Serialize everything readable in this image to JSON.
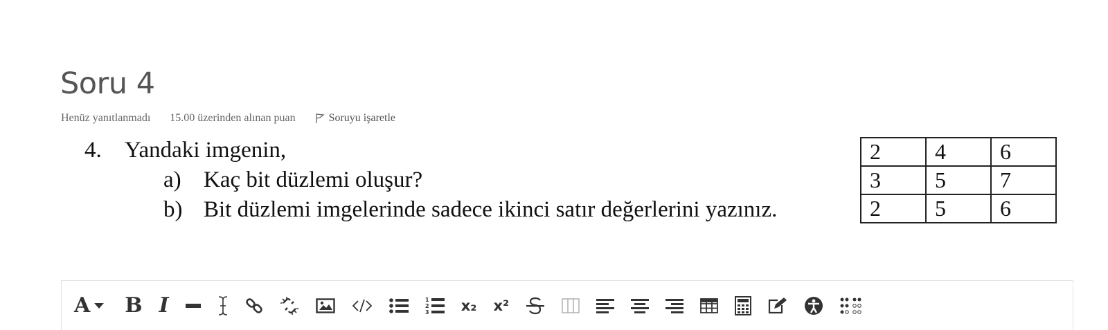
{
  "question": {
    "title": "Soru 4",
    "status": "Henüz yanıtlanmadı",
    "points": "15.00 üzerinden alınan puan",
    "flag_label": "Soruyu işaretle",
    "number": "4.",
    "prompt": "Yandaki imgenin,",
    "subs": [
      {
        "label": "a)",
        "text": "Kaç bit düzlemi oluşur?"
      },
      {
        "label": "b)",
        "text": "Bit düzlemi imgelerinde sadece ikinci satır değerlerini yazınız."
      }
    ],
    "table": [
      [
        "2",
        "4",
        "6"
      ],
      [
        "3",
        "5",
        "7"
      ],
      [
        "2",
        "5",
        "6"
      ]
    ]
  },
  "toolbar": {
    "font_label": "A",
    "bold_label": "B",
    "italic_label": "I",
    "subscript_label": "x₂",
    "superscript_label": "x²",
    "buttons": [
      "font-family",
      "bold",
      "italic",
      "horizontal-rule",
      "clear-formatting",
      "link",
      "unlink",
      "image",
      "code",
      "unordered-list",
      "ordered-list",
      "subscript",
      "superscript",
      "strikethrough",
      "columns",
      "align-left",
      "align-center",
      "align-right",
      "table",
      "calculator",
      "edit",
      "accessibility",
      "braille"
    ]
  }
}
